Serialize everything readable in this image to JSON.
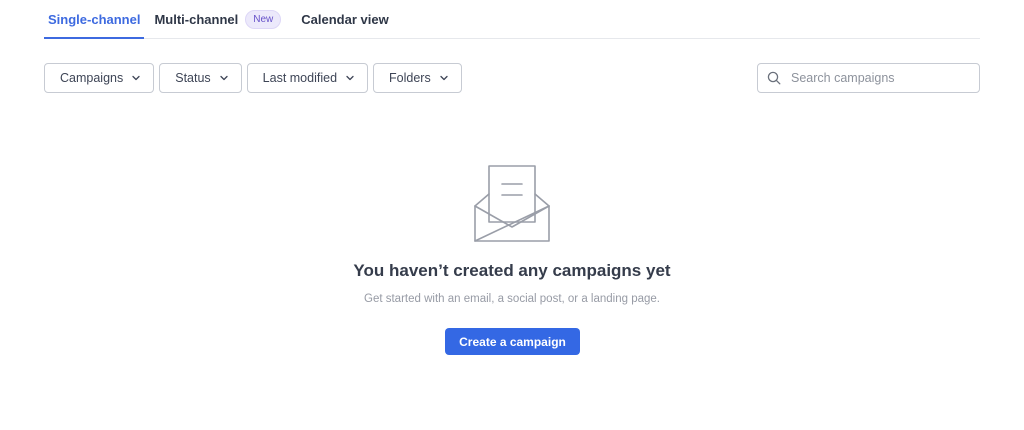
{
  "tabs": [
    {
      "label": "Single-channel",
      "active": true
    },
    {
      "label": "Multi-channel",
      "badge": "New"
    },
    {
      "label": "Calendar view"
    }
  ],
  "filters": {
    "campaigns": "Campaigns",
    "status": "Status",
    "last_modified": "Last modified",
    "folders": "Folders"
  },
  "search": {
    "placeholder": "Search campaigns",
    "value": ""
  },
  "empty_state": {
    "icon": "envelope-open-icon",
    "title": "You haven’t created any campaigns yet",
    "subtitle": "Get started with an email, a social post, or a landing page.",
    "cta_label": "Create a campaign"
  },
  "colors": {
    "accent": "#3468e4",
    "tab_active": "#3d6ae0",
    "badge_text": "#6651c9",
    "badge_bg": "#ece9fb"
  }
}
